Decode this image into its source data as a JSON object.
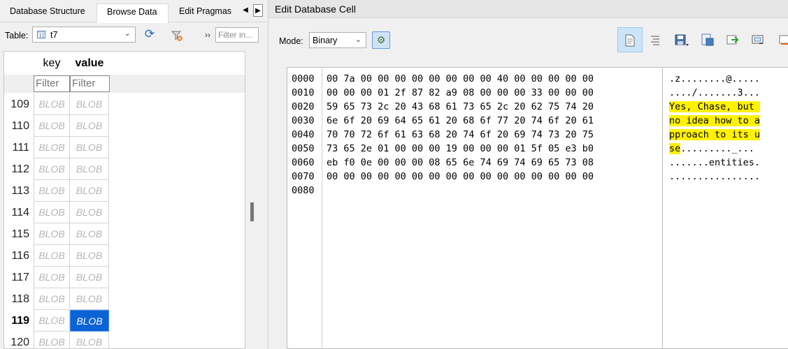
{
  "tabs": [
    {
      "label": "Database Structure",
      "active": false
    },
    {
      "label": "Browse Data",
      "active": true
    },
    {
      "label": "Edit Pragmas",
      "active": false
    }
  ],
  "tab_scroll": {
    "left": "◀",
    "right": "▶"
  },
  "table_bar": {
    "label": "Table:",
    "selected_table": "t7",
    "more": "››",
    "filter_placeholder": "Filter in..."
  },
  "grid": {
    "columns": [
      "key",
      "value"
    ],
    "filter_placeholder": "Filter",
    "rows": [
      {
        "num": "109",
        "key": "BLOB",
        "value": "BLOB"
      },
      {
        "num": "110",
        "key": "BLOB",
        "value": "BLOB"
      },
      {
        "num": "111",
        "key": "BLOB",
        "value": "BLOB"
      },
      {
        "num": "112",
        "key": "BLOB",
        "value": "BLOB"
      },
      {
        "num": "113",
        "key": "BLOB",
        "value": "BLOB"
      },
      {
        "num": "114",
        "key": "BLOB",
        "value": "BLOB"
      },
      {
        "num": "115",
        "key": "BLOB",
        "value": "BLOB"
      },
      {
        "num": "116",
        "key": "BLOB",
        "value": "BLOB"
      },
      {
        "num": "117",
        "key": "BLOB",
        "value": "BLOB"
      },
      {
        "num": "118",
        "key": "BLOB",
        "value": "BLOB"
      },
      {
        "num": "119",
        "key": "BLOB",
        "value": "BLOB"
      },
      {
        "num": "120",
        "key": "BLOB",
        "value": "BLOB"
      }
    ],
    "current_row": "119",
    "selected_cell": {
      "row": "119",
      "column": "value"
    }
  },
  "editor": {
    "title": "Edit Database Cell",
    "mode_label": "Mode:",
    "mode_value": "Binary",
    "toolbar_icons": [
      "text-view-icon",
      "word-wrap-icon",
      "save-cell-icon",
      "export-icon",
      "import-icon",
      "apply-icon",
      "set-null-icon"
    ]
  },
  "hex": {
    "lines": [
      {
        "offset": "0000",
        "hex": "00 7a 00 00 00 00 00 00 00 00 40 00 00 00 00 00",
        "ascii": ".z........@....."
      },
      {
        "offset": "0010",
        "hex": "00 00 00 01 2f 87 82 a9 08 00 00 00 33 00 00 00",
        "ascii": "..../.......3..."
      },
      {
        "offset": "0020",
        "hex": "59 65 73 2c 20 43 68 61 73 65 2c 20 62 75 74 20",
        "ascii_pre": "",
        "ascii_hl": "Yes, Chase, but ",
        "ascii_post": ""
      },
      {
        "offset": "0030",
        "hex": "6e 6f 20 69 64 65 61 20 68 6f 77 20 74 6f 20 61",
        "ascii_pre": "",
        "ascii_hl": "no idea how to a",
        "ascii_post": ""
      },
      {
        "offset": "0040",
        "hex": "70 70 72 6f 61 63 68 20 74 6f 20 69 74 73 20 75",
        "ascii_pre": "",
        "ascii_hl": "pproach to its u",
        "ascii_post": ""
      },
      {
        "offset": "0050",
        "hex": "73 65 2e 01 00 00 00 19 00 00 00 01 5f 05 e3 b0",
        "ascii_pre": "",
        "ascii_hl": "se",
        "ascii_post": "........._..."
      },
      {
        "offset": "0060",
        "hex": "eb f0 0e 00 00 00 08 65 6e 74 69 74 69 65 73 08",
        "ascii": ".......entities."
      },
      {
        "offset": "0070",
        "hex": "00 00 00 00 00 00 00 00 00 00 00 00 00 00 00 00",
        "ascii": "................"
      },
      {
        "offset": "0080",
        "hex": "",
        "ascii": ""
      }
    ]
  },
  "colors": {
    "selection": "#0a64d6",
    "highlight": "#fff200",
    "accent_icon": "#2a6ebb"
  }
}
